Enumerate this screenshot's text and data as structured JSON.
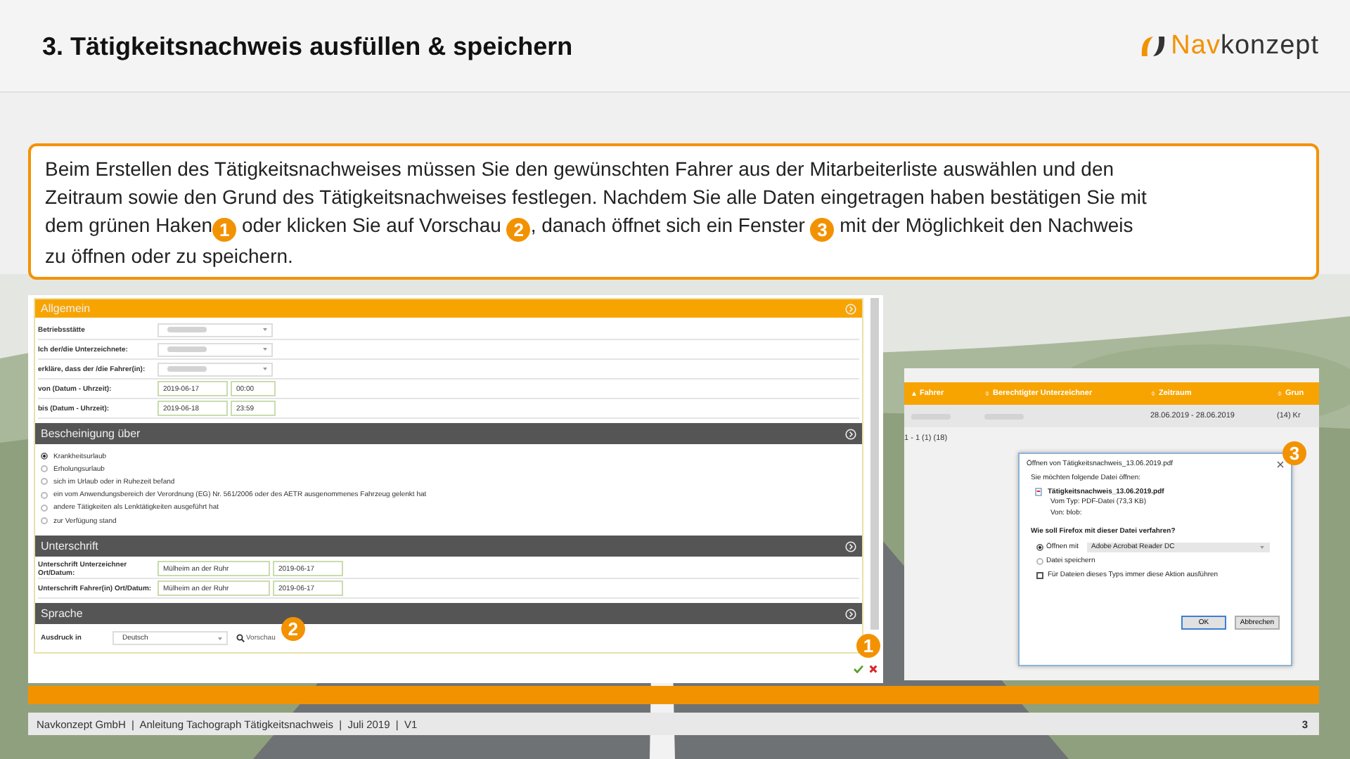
{
  "slide": {
    "title": "3. Tätigkeitsnachweis ausfüllen & speichern",
    "logo": {
      "prefix": "Nav",
      "suffix": "konzept"
    }
  },
  "intro": [
    [
      {
        "kind": "text",
        "text": "Beim Erstellen des Tätigkeitsnachweises müssen Sie den gewünschten Fahrer aus der Mitarbeiterliste auswählen und den"
      }
    ],
    [
      {
        "kind": "text",
        "text": "Zeitraum sowie den Grund des Tätigkeitsnachweises festlegen. Nachdem Sie alle Daten eingetragen haben bestätigen Sie mit"
      }
    ],
    [
      {
        "kind": "text",
        "text": "dem grünen Haken"
      },
      {
        "kind": "badge",
        "text": "1"
      },
      {
        "kind": "text",
        "text": " oder klicken Sie auf Vorschau "
      },
      {
        "kind": "badge",
        "text": "2"
      },
      {
        "kind": "text",
        "text": ", danach öffnet sich ein Fenster "
      },
      {
        "kind": "badge",
        "text": "3"
      },
      {
        "kind": "text",
        "text": " mit der Möglichkeit den Nachweis"
      }
    ],
    [
      {
        "kind": "text",
        "text": "zu öffnen oder zu speichern."
      }
    ]
  ],
  "form": {
    "sections": [
      {
        "title": "Allgemein",
        "highlighted": true,
        "kind": "fields",
        "items": [
          {
            "kind": "select",
            "label": "Betriebsstätte"
          },
          {
            "kind": "select",
            "label": "Ich der/die Unterzeichnete:"
          },
          {
            "kind": "select",
            "label": "erkläre, dass der /die Fahrer(in):"
          },
          {
            "kind": "datetime",
            "label": "von (Datum - Uhrzeit):",
            "date": "2019-06-17",
            "time": "00:00"
          },
          {
            "kind": "datetime",
            "label": "bis (Datum - Uhrzeit):",
            "date": "2019-06-18",
            "time": "23:59"
          }
        ]
      },
      {
        "title": "Bescheinigung über",
        "highlighted": false,
        "kind": "radios",
        "items": [
          {
            "label": "Krankheitsurlaub",
            "selected": true
          },
          {
            "label": "Erholungsurlaub",
            "selected": false
          },
          {
            "label": "sich im Urlaub oder in Ruhezeit befand",
            "selected": false
          },
          {
            "label": "ein vom Anwendungsbereich der Verordnung (EG) Nr. 561/2006 oder des AETR ausgenommenes Fahrzeug gelenkt hat",
            "selected": false
          },
          {
            "label": "andere Tätigkeiten als Lenktätigkeiten ausgeführt hat",
            "selected": false
          },
          {
            "label": "zur Verfügung stand",
            "selected": false
          }
        ]
      },
      {
        "title": "Unterschrift",
        "highlighted": false,
        "kind": "fields",
        "items": [
          {
            "kind": "place_date",
            "label": "Unterschrift Unterzeichner Ort/Datum:",
            "place": "Mülheim an der Ruhr",
            "date": "2019-06-17"
          },
          {
            "kind": "place_date",
            "label": "Unterschrift Fahrer(in) Ort/Datum:",
            "place": "Mülheim an der Ruhr",
            "date": "2019-06-17"
          }
        ]
      },
      {
        "title": "Sprache",
        "highlighted": false,
        "kind": "language",
        "label": "Ausdruck in",
        "value": "Deutsch",
        "link": "Vorschau",
        "badge": "2"
      }
    ],
    "confirm_badge": "1"
  },
  "list": {
    "columns": [
      {
        "label": "Fahrer",
        "sorted": true
      },
      {
        "label": "Berechtigter Unterzeichner",
        "sorted": false
      },
      {
        "label": "Zeitraum",
        "sorted": false
      },
      {
        "label": "Grun",
        "sorted": false
      }
    ],
    "row": {
      "period": "28.06.2019 - 28.06.2019",
      "reason": "(14) Kr"
    },
    "pager": "1 - 1 (1) (18)"
  },
  "dialog": {
    "title": "Öffnen von Tätigkeitsnachweis_13.06.2019.pdf",
    "badge": "3",
    "intro": "Sie möchten folgende Datei öffnen:",
    "file": "Tätigkeitsnachweis_13.06.2019.pdf",
    "type": "Vom Typ: PDF-Datei (73,3 KB)",
    "source": "Von:  blob:",
    "question": "Wie soll Firefox mit dieser Datei verfahren?",
    "options": [
      {
        "label": "Öffnen mit",
        "selected": true,
        "app": "Adobe Acrobat Reader DC"
      },
      {
        "label": "Datei speichern",
        "selected": false
      }
    ],
    "remember": {
      "label": "Für Dateien dieses Typs immer diese Aktion ausführen",
      "checked": false
    },
    "buttons": [
      "OK",
      "Abbrechen"
    ]
  },
  "footer": {
    "text": "Navkonzept GmbH  |  Anleitung Tachograph Tätigkeitsnachweis  |  Juli 2019  |  V1",
    "page": "3"
  }
}
